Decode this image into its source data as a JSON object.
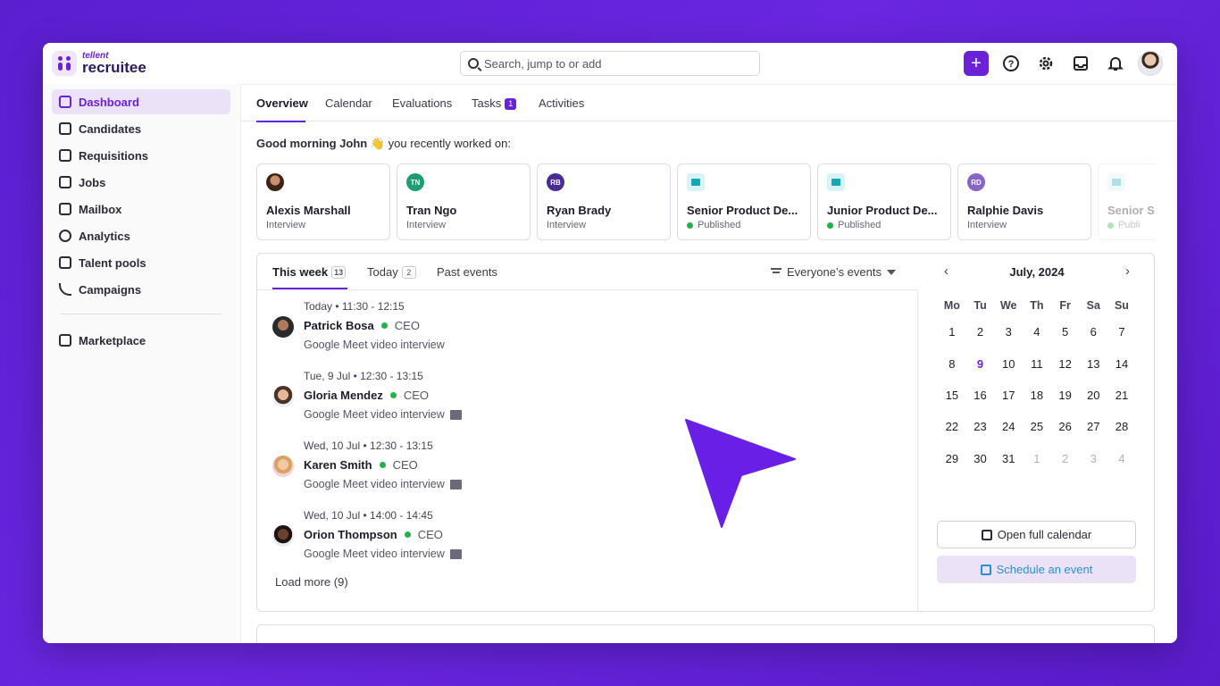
{
  "logo": {
    "small": "tellent",
    "big": "recruitee"
  },
  "search": {
    "placeholder": "Search, jump to or add"
  },
  "sidebar": {
    "items": [
      {
        "label": "Dashboard",
        "icon": "home-icon",
        "active": true
      },
      {
        "label": "Candidates",
        "icon": "users-icon"
      },
      {
        "label": "Requisitions",
        "icon": "clipboard-icon"
      },
      {
        "label": "Jobs",
        "icon": "briefcase-icon"
      },
      {
        "label": "Mailbox",
        "icon": "mail-icon"
      },
      {
        "label": "Analytics",
        "icon": "pie-chart-icon"
      },
      {
        "label": "Talent pools",
        "icon": "folder-icon"
      },
      {
        "label": "Campaigns",
        "icon": "rss-icon"
      },
      {
        "label": "Marketplace",
        "icon": "store-icon"
      }
    ]
  },
  "tabs": [
    {
      "label": "Overview",
      "active": true
    },
    {
      "label": "Calendar"
    },
    {
      "label": "Evaluations"
    },
    {
      "label": "Tasks",
      "count": "1"
    },
    {
      "label": "Activities"
    }
  ],
  "greeting": {
    "bold": "Good morning John",
    "emoji": "👋",
    "rest": " you recently worked on:"
  },
  "recent": [
    {
      "title": "Alexis Marshall",
      "sub": "Interview",
      "type": "person"
    },
    {
      "title": "Tran Ngo",
      "sub": "Interview",
      "type": "initials",
      "initials": "TN",
      "color": "#1f9d72"
    },
    {
      "title": "Ryan Brady",
      "sub": "Interview",
      "type": "initials",
      "initials": "RB",
      "color": "#4b2a9a"
    },
    {
      "title": "Senior Product De...",
      "sub": "Published",
      "type": "job"
    },
    {
      "title": "Junior Product De...",
      "sub": "Published",
      "type": "job"
    },
    {
      "title": "Ralphie Davis",
      "sub": "Interview",
      "type": "initials",
      "initials": "RD",
      "color": "#8a63c9"
    },
    {
      "title": "Senior S",
      "sub": "Publi",
      "type": "job"
    }
  ],
  "events": {
    "tabs": [
      {
        "label": "This week",
        "count": "13",
        "active": true
      },
      {
        "label": "Today",
        "count": "2"
      },
      {
        "label": "Past events"
      }
    ],
    "filter": "Everyone’s events",
    "items": [
      {
        "time": "Today • 11:30 - 12:15",
        "name": "Patrick Bosa",
        "role": "CEO",
        "desc": "Google Meet video interview",
        "msg": false
      },
      {
        "time": "Tue, 9 Jul • 12:30 - 13:15",
        "name": "Gloria Mendez",
        "role": "CEO",
        "desc": "Google Meet video interview",
        "msg": true
      },
      {
        "time": "Wed, 10 Jul • 12:30 - 13:15",
        "name": "Karen Smith",
        "role": "CEO",
        "desc": "Google Meet video interview",
        "msg": true
      },
      {
        "time": "Wed, 10 Jul • 14:00 - 14:45",
        "name": "Orion Thompson",
        "role": "CEO",
        "desc": "Google Meet video interview",
        "msg": true
      }
    ],
    "load_more": "Load more (9)"
  },
  "calendar": {
    "month": "July, 2024",
    "weekdays": [
      "Mo",
      "Tu",
      "We",
      "Th",
      "Fr",
      "Sa",
      "Su"
    ],
    "weeks": [
      [
        "1",
        "2",
        "3",
        "4",
        "5",
        "6",
        "7"
      ],
      [
        "8",
        "9",
        "10",
        "11",
        "12",
        "13",
        "14"
      ],
      [
        "15",
        "16",
        "17",
        "18",
        "19",
        "20",
        "21"
      ],
      [
        "22",
        "23",
        "24",
        "25",
        "26",
        "27",
        "28"
      ],
      [
        "29",
        "30",
        "31",
        "1",
        "2",
        "3",
        "4"
      ]
    ],
    "open_full": "Open full calendar",
    "schedule": "Schedule an event"
  },
  "colors": {
    "accent": "#6b21d6",
    "background": "#5b1fd0",
    "published": "#20b34a"
  }
}
